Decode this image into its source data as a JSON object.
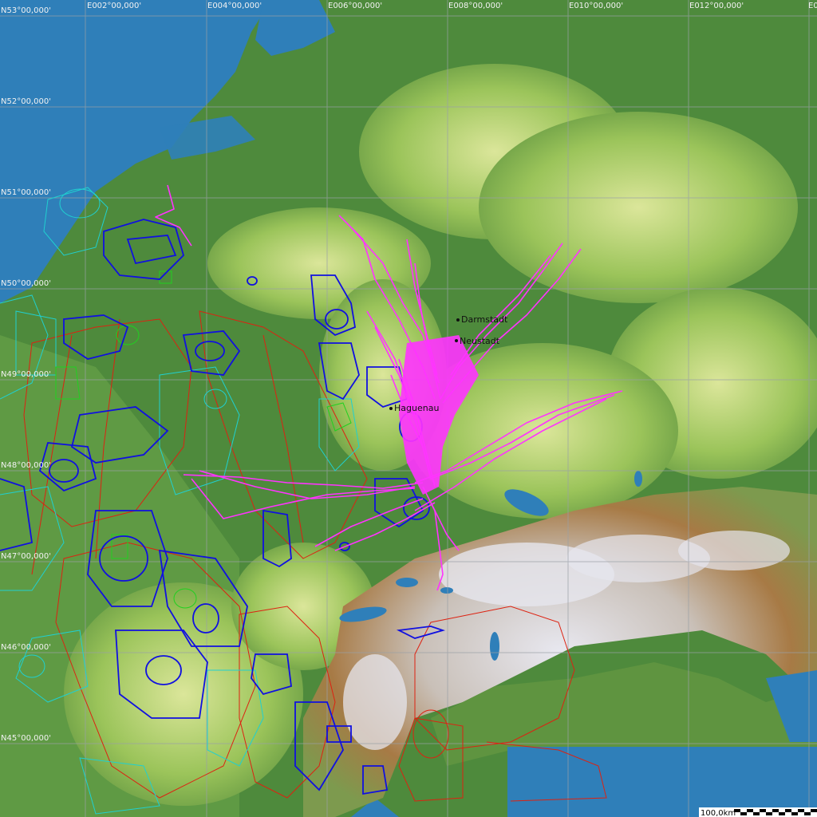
{
  "map": {
    "longitude_labels": [
      "E002°00,000'",
      "E004°00,000'",
      "E006°00,000'",
      "E008°00,000'",
      "E010°00,000'",
      "E012°00,000'",
      "E0"
    ],
    "latitude_labels": [
      "N53°00,000'",
      "N52°00,000'",
      "N51°00,000'",
      "N50°00,000'",
      "N49°00,000'",
      "N48°00,000'",
      "N47°00,000'",
      "N46°00,000'",
      "N45°00,000'"
    ],
    "places": [
      "Darmstadt",
      "Neustadt",
      "Haguenau"
    ],
    "scale_label": "100,0km",
    "colors": {
      "water": "#2f7fb9",
      "lowland": "#4a7c3a",
      "hills": "#9bc45a",
      "alps": "#a77a45",
      "snow": "#e6e6ee",
      "tracks": "#ff33ff",
      "airspace_blue": "#1010e0",
      "airspace_cyan": "#20d0d0",
      "airspace_red": "#dd2211",
      "grid": "#9aa0a6"
    }
  }
}
